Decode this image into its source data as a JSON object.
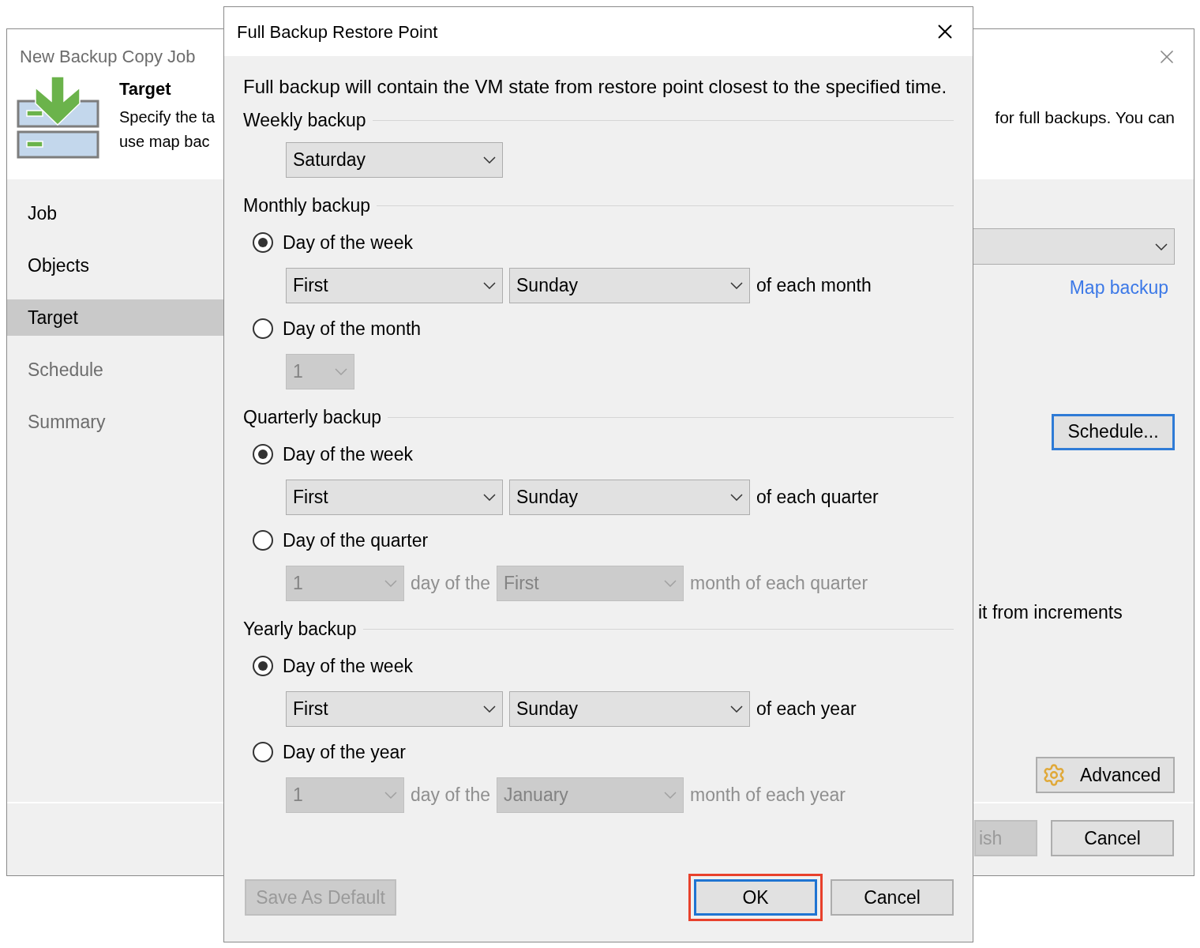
{
  "background_window": {
    "title": "New Backup Copy Job",
    "header": {
      "heading": "Target",
      "description_left": [
        "Specify the ta",
        "use map bac"
      ],
      "description_right": "for full backups. You can"
    },
    "nav": [
      {
        "label": "Job",
        "selected": false,
        "disabled": false
      },
      {
        "label": "Objects",
        "selected": false,
        "disabled": false
      },
      {
        "label": "Target",
        "selected": true,
        "disabled": false
      },
      {
        "label": "Schedule",
        "selected": false,
        "disabled": true
      },
      {
        "label": "Summary",
        "selected": false,
        "disabled": true
      }
    ],
    "map_backup_link": "Map backup",
    "schedule_button": {
      "label": "Schedule...",
      "focused": true
    },
    "text_fragment": "it from increments",
    "advanced_button": "Advanced",
    "footer_buttons": [
      {
        "label": "ish",
        "disabled": true
      },
      {
        "label": "Cancel",
        "disabled": false
      }
    ]
  },
  "dialog": {
    "title": "Full Backup Restore Point",
    "description": "Full backup will contain the VM state from restore point closest to the specified time.",
    "groups": [
      {
        "title": "Weekly backup",
        "combo": {
          "value": "Saturday"
        }
      },
      {
        "title": "Monthly backup",
        "options": [
          {
            "label": "Day of the week",
            "selected": true,
            "controls": [
              {
                "kind": "combo",
                "value": "First",
                "disabled": false
              },
              {
                "kind": "combo",
                "value": "Sunday",
                "disabled": false
              },
              {
                "kind": "text",
                "value": "of each month",
                "disabled": false
              }
            ]
          },
          {
            "label": "Day of the month",
            "selected": false,
            "controls": [
              {
                "kind": "combo",
                "value": "1",
                "disabled": true
              }
            ]
          }
        ]
      },
      {
        "title": "Quarterly backup",
        "options": [
          {
            "label": "Day of the week",
            "selected": true,
            "controls": [
              {
                "kind": "combo",
                "value": "First",
                "disabled": false
              },
              {
                "kind": "combo",
                "value": "Sunday",
                "disabled": false
              },
              {
                "kind": "text",
                "value": "of each quarter",
                "disabled": false
              }
            ]
          },
          {
            "label": "Day of the quarter",
            "selected": false,
            "controls": [
              {
                "kind": "combo",
                "value": "1",
                "disabled": true
              },
              {
                "kind": "text",
                "value": "day of the",
                "disabled": true
              },
              {
                "kind": "combo",
                "value": "First",
                "disabled": true
              },
              {
                "kind": "text",
                "value": "month of each quarter",
                "disabled": true
              }
            ]
          }
        ]
      },
      {
        "title": "Yearly backup",
        "options": [
          {
            "label": "Day of the week",
            "selected": true,
            "controls": [
              {
                "kind": "combo",
                "value": "First",
                "disabled": false
              },
              {
                "kind": "combo",
                "value": "Sunday",
                "disabled": false
              },
              {
                "kind": "text",
                "value": "of each year",
                "disabled": false
              }
            ]
          },
          {
            "label": "Day of the year",
            "selected": false,
            "controls": [
              {
                "kind": "combo",
                "value": "1",
                "disabled": true
              },
              {
                "kind": "text",
                "value": "day of the",
                "disabled": true
              },
              {
                "kind": "combo",
                "value": "January",
                "disabled": true
              },
              {
                "kind": "text",
                "value": "month of each year",
                "disabled": true
              }
            ]
          }
        ]
      }
    ],
    "buttons": [
      {
        "label": "Save As Default",
        "disabled": true,
        "focused": false,
        "highlighted": false
      },
      {
        "label": "OK",
        "disabled": false,
        "focused": true,
        "highlighted": true
      },
      {
        "label": "Cancel",
        "disabled": false,
        "focused": false,
        "highlighted": false
      }
    ]
  }
}
